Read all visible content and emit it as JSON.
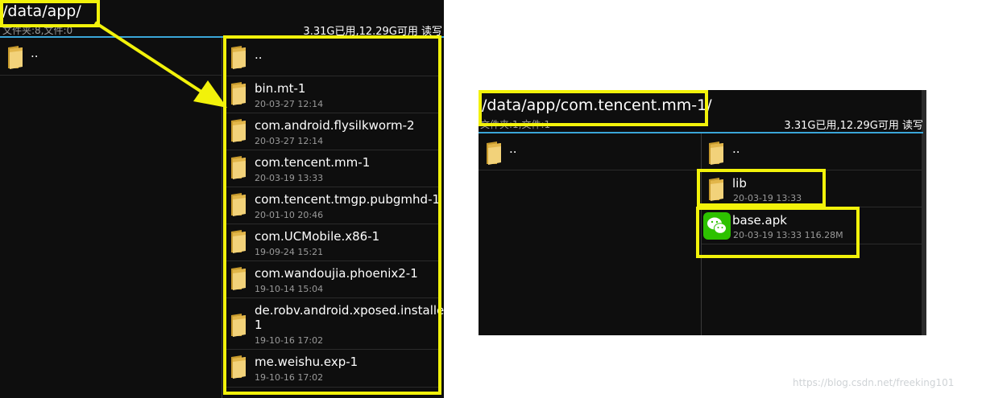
{
  "left_panel": {
    "path": "/data/app/",
    "summary": "文件夹:8,文件:0",
    "storage": "3.31G已用,12.29G可用  读写",
    "left_pane_entries": [
      {
        "name": ".."
      }
    ],
    "right_pane_entries": [
      {
        "name": "..",
        "date": ""
      },
      {
        "name": "bin.mt-1",
        "date": "20-03-27 12:14"
      },
      {
        "name": "com.android.flysilkworm-2",
        "date": "20-03-27 12:14"
      },
      {
        "name": "com.tencent.mm-1",
        "date": "20-03-19 13:33"
      },
      {
        "name": "com.tencent.tmgp.pubgmhd-1",
        "date": "20-01-10 20:46"
      },
      {
        "name": "com.UCMobile.x86-1",
        "date": "19-09-24 15:21"
      },
      {
        "name": "com.wandoujia.phoenix2-1",
        "date": "19-10-14 15:04"
      },
      {
        "name": "de.robv.android.xposed.installer-",
        "name2": "1",
        "date": "19-10-16 17:02"
      },
      {
        "name": "me.weishu.exp-1",
        "date": "19-10-16 17:02"
      }
    ]
  },
  "right_panel": {
    "path": "/data/app/com.tencent.mm-1/",
    "summary": "文件夹:1,文件:1",
    "storage": "3.31G已用,12.29G可用  读写",
    "left_pane_entries": [
      {
        "name": ".."
      }
    ],
    "right_pane_entries": [
      {
        "name": "..",
        "date": ""
      },
      {
        "name": "lib",
        "date": "20-03-19 13:33"
      },
      {
        "name": "base.apk",
        "date": "20-03-19 13:33  116.28M",
        "icon": "wechat-icon"
      }
    ]
  },
  "watermark": "https://blog.csdn.net/freeking101",
  "colors": {
    "highlight": "#f2f20a",
    "separator": "#3aa6d8",
    "folder": "#e8c05a",
    "wechat": "#2dc100"
  }
}
